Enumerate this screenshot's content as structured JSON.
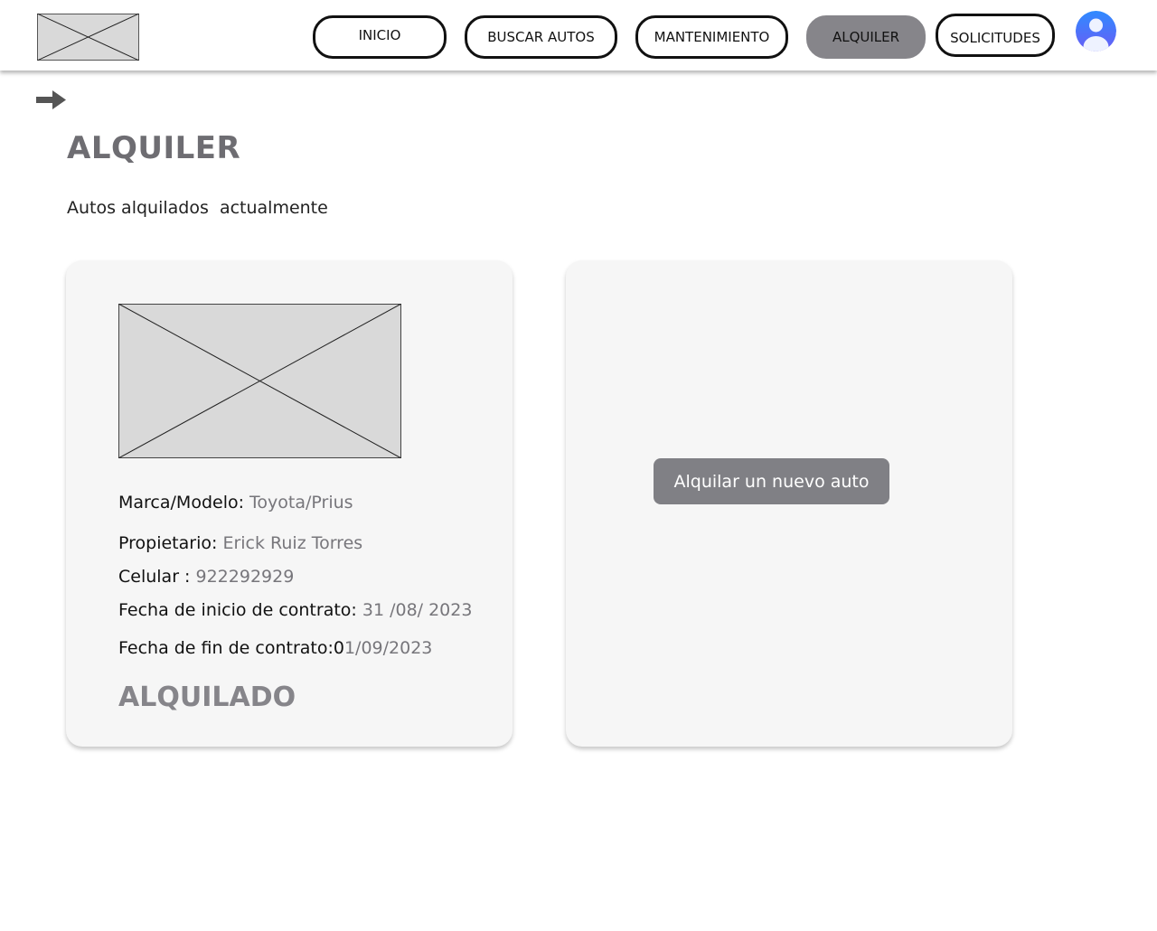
{
  "header": {
    "logo_icon": "image-placeholder-icon",
    "nav": [
      {
        "label": "INICIO"
      },
      {
        "label": "BUSCAR AUTOS"
      },
      {
        "label": "MANTENIMIENTO"
      },
      {
        "label": "ALQUILER",
        "active": true
      },
      {
        "label": "SOLICITUDES"
      }
    ],
    "avatar_icon": "user-avatar-icon"
  },
  "back_icon": "arrow-right-icon",
  "page": {
    "title": "ALQUILER",
    "subtitle": "Autos alquilados  actualmente"
  },
  "rental_card": {
    "image_icon": "car-image-placeholder",
    "brand_model_label": "Marca/Modelo:",
    "brand_model_value": "Toyota/Prius",
    "owner_label": "Propietario:",
    "owner_value": "Erick Ruiz Torres",
    "phone_label": "Celular :",
    "phone_value": "922292929",
    "start_label": "Fecha de inicio de contrato:",
    "start_value": "31 /08/ 2023",
    "end_label": "Fecha de fin de contrato:0",
    "end_value": "1/09/2023",
    "status": "ALQUILADO"
  },
  "new_rental": {
    "button_label": "Alquilar un nuevo auto"
  },
  "colors": {
    "active_nav": "#86858a",
    "title": "#6e6d72",
    "card_bg": "#f6f6f6",
    "button_bg": "#808085",
    "avatar_gradient_top": "#2f8bff",
    "avatar_gradient_bottom": "#6a5cf5"
  }
}
